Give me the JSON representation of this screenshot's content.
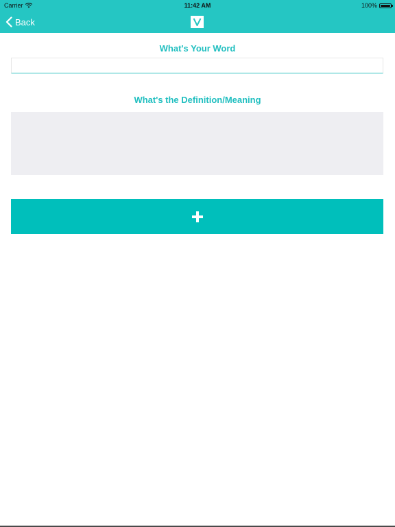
{
  "status_bar": {
    "carrier": "Carrier",
    "time": "11:42 AM",
    "battery": "100%"
  },
  "nav": {
    "back_label": "Back",
    "logo_icon": "v-logo-icon"
  },
  "form": {
    "word_label": "What's Your Word",
    "word_value": "",
    "definition_label": "What's the Definition/Meaning",
    "definition_value": "",
    "add_icon": "plus-icon"
  },
  "colors": {
    "header": "#25c6c3",
    "accent_text": "#21bfc0",
    "button": "#00bfbb",
    "textarea_bg": "#eeeef2"
  }
}
